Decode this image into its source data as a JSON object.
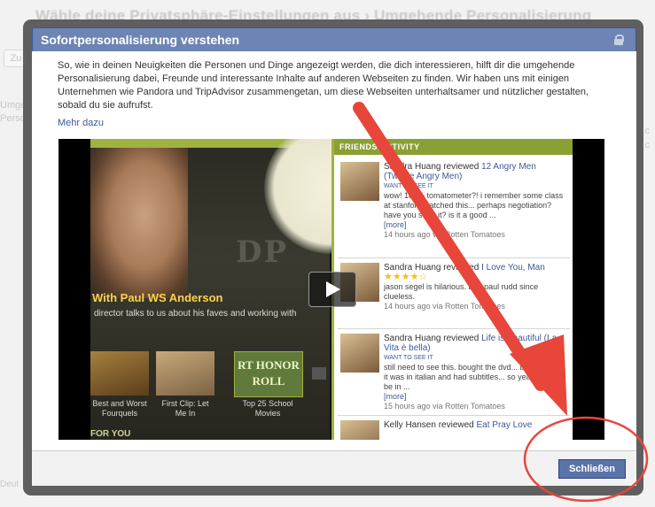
{
  "background": {
    "title": "Wähle deine Privatsphäre-Einstellungen aus › Umgehende Personalisierung",
    "tab": "Zu",
    "left_lines": [
      "Umge",
      "Perso"
    ],
    "footer": "Deut"
  },
  "dialog": {
    "title": "Sofortpersonalisierung verstehen",
    "description": "So, wie in deinen Neuigkeiten die Personen und Dinge angezeigt werden, die dich interessieren, hilft dir die umgehende Personalisierung dabei, Freunde und interessante Inhalte auf anderen Webseiten zu finden. Wir haben uns mit einigen Unternehmen wie Pandora und TripAdvisor zusammengetan, um diese Webseiten unterhaltsamer und nützlicher gestalten, sobald du sie aufrufst.",
    "more_link": "Mehr dazu",
    "close_button": "Schließen"
  },
  "video": {
    "caption": "With Paul WS Anderson",
    "subcaption": "director talks to us about his faves and working with",
    "thumbs": [
      {
        "caption": "Best and Worst Fourquels"
      },
      {
        "caption": "First Clip: Let Me In"
      },
      {
        "title": "RT HONOR ROLL",
        "caption": "Top 25 School Movies"
      }
    ],
    "bottom_label": "FOR YOU",
    "activity_header": "FRIENDS ACTIVITY",
    "activity": [
      {
        "name": "Sandra Huang reviewed",
        "movie": "12 Angry Men (Twelve Angry Men)",
        "tag": "WANT TO SEE IT",
        "text": "wow! 100% tomatometer?! i remember some class at stanford watched this... perhaps negotiation? have you seen it? is it a good ...",
        "more": "[more]",
        "meta": "14 hours ago via Rotten Tomatoes"
      },
      {
        "name": "Sandra Huang reviewed",
        "movie": "I Love You, Man",
        "stars": "★★★★☆",
        "text": "jason segel is hilarious. and paul rudd since clueless.",
        "meta": "14 hours ago via Rotten Tomatoes"
      },
      {
        "name": "Sandra Huang reviewed",
        "movie": "Life is Beautiful (La Vita è bella)",
        "tag": "WANT TO SEE IT",
        "text": "still need to see this. bought the dvd... but realized it was in italian and had subtitles... so yeah, need to be in ...",
        "more": "[more]",
        "meta": "15 hours ago via Rotten Tomatoes"
      },
      {
        "name": "Kelly Hansen reviewed",
        "movie": "Eat Pray Love"
      }
    ]
  }
}
